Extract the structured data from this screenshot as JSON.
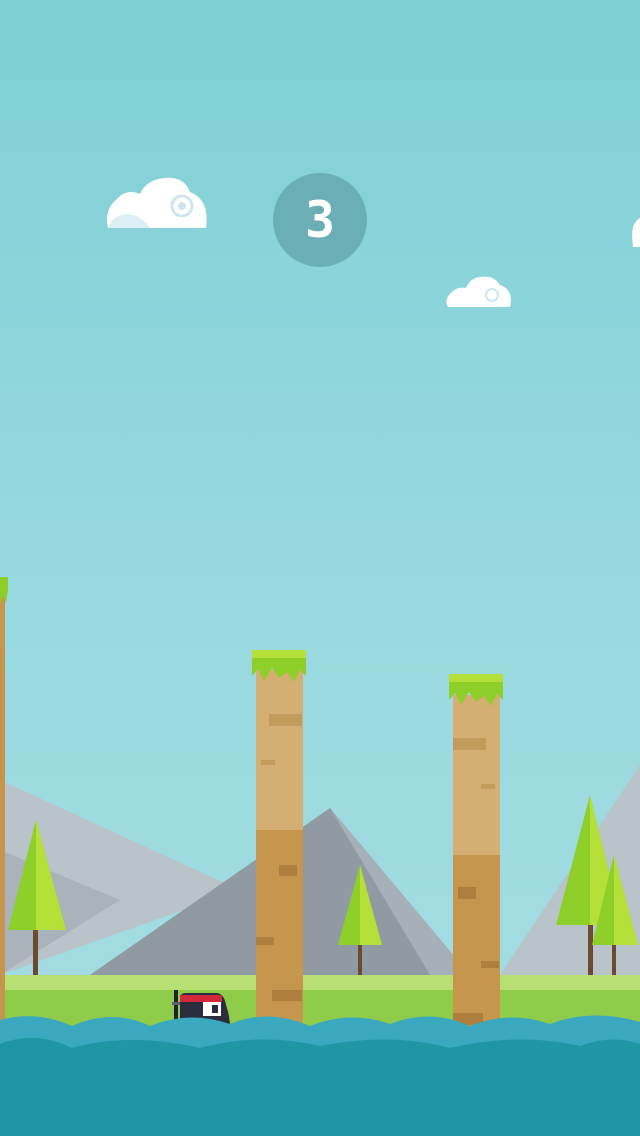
{
  "game": {
    "score": "3"
  },
  "scene": {
    "sky_color_top": "#7ecfd6",
    "sky_color_bottom": "#a6dee3",
    "mountain_colors": [
      "#b9c3ca",
      "#8f9aa3"
    ],
    "grass_color": "#8fcc4a",
    "water_color": "#1f96a3",
    "pillar_colors": [
      "#d4ae72",
      "#c6964f"
    ],
    "player": "ninja-character"
  },
  "icons": {
    "score_badge": "circle-badge",
    "clouds": "cloud-icon",
    "trees": "pine-tree-icon"
  }
}
